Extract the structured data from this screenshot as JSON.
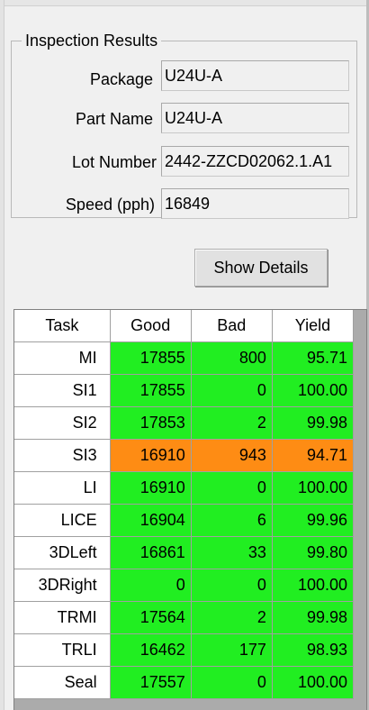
{
  "colors": {
    "good": "#21ee21",
    "warning": "#fe8c14"
  },
  "inspection": {
    "title": "Inspection Results",
    "fields": [
      {
        "label": "Package",
        "value": "U24U-A"
      },
      {
        "label": "Part Name",
        "value": "U24U-A"
      },
      {
        "label": "Lot Number",
        "value": "2442-ZZCD02062.1.A1"
      },
      {
        "label": "Speed (pph)",
        "value": "16849"
      }
    ]
  },
  "show_details_label": "Show Details",
  "table": {
    "headers": [
      "Task",
      "Good",
      "Bad",
      "Yield"
    ],
    "rows": [
      {
        "task": "MI",
        "good": "17855",
        "bad": "800",
        "yield": "95.71",
        "status": "good"
      },
      {
        "task": "SI1",
        "good": "17855",
        "bad": "0",
        "yield": "100.00",
        "status": "good"
      },
      {
        "task": "SI2",
        "good": "17853",
        "bad": "2",
        "yield": "99.98",
        "status": "good"
      },
      {
        "task": "SI3",
        "good": "16910",
        "bad": "943",
        "yield": "94.71",
        "status": "warning"
      },
      {
        "task": "LI",
        "good": "16910",
        "bad": "0",
        "yield": "100.00",
        "status": "good"
      },
      {
        "task": "LICE",
        "good": "16904",
        "bad": "6",
        "yield": "99.96",
        "status": "good"
      },
      {
        "task": "3DLeft",
        "good": "16861",
        "bad": "33",
        "yield": "99.80",
        "status": "good"
      },
      {
        "task": "3DRight",
        "good": "0",
        "bad": "0",
        "yield": "100.00",
        "status": "good"
      },
      {
        "task": "TRMI",
        "good": "17564",
        "bad": "2",
        "yield": "99.98",
        "status": "good"
      },
      {
        "task": "TRLI",
        "good": "16462",
        "bad": "177",
        "yield": "98.93",
        "status": "good"
      },
      {
        "task": "Seal",
        "good": "17557",
        "bad": "0",
        "yield": "100.00",
        "status": "good"
      }
    ]
  }
}
